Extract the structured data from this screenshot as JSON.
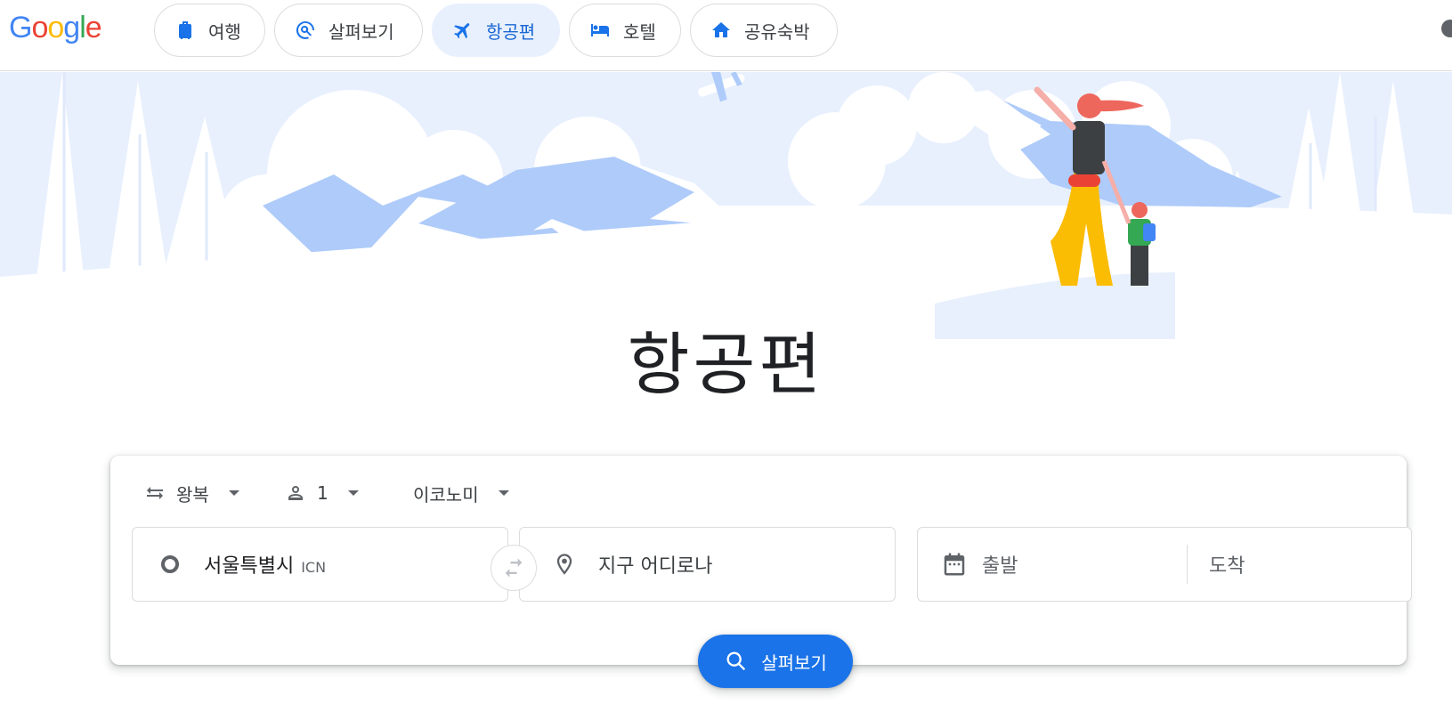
{
  "app": {
    "logo_letters": [
      {
        "ch": "G",
        "color": "#4285F4"
      },
      {
        "ch": "o",
        "color": "#EA4335"
      },
      {
        "ch": "o",
        "color": "#FBBC05"
      },
      {
        "ch": "g",
        "color": "#4285F4"
      },
      {
        "ch": "l",
        "color": "#34A853"
      },
      {
        "ch": "e",
        "color": "#EA4335"
      }
    ]
  },
  "nav": {
    "tabs": [
      {
        "label": "여행",
        "icon": "luggage-icon"
      },
      {
        "label": "살펴보기",
        "icon": "explore-icon"
      },
      {
        "label": "항공편",
        "icon": "airplane-icon",
        "active": true
      },
      {
        "label": "호텔",
        "icon": "bed-icon"
      },
      {
        "label": "공유숙박",
        "icon": "home-icon"
      }
    ]
  },
  "hero": {
    "title": "항공편"
  },
  "search": {
    "trip_type": "왕복",
    "passengers": "1",
    "cabin_class": "이코노미",
    "origin": {
      "value": "서울특별시",
      "code": "ICN"
    },
    "destination_placeholder": "지구 어디로나",
    "departure_placeholder": "출발",
    "return_placeholder": "도착",
    "submit_label": "살펴보기"
  },
  "colors": {
    "accent": "#1a73e8",
    "active_chip_bg": "#e8f0fe",
    "hero_light": "#e8f0fe",
    "hero_mid": "#aecbfa"
  }
}
